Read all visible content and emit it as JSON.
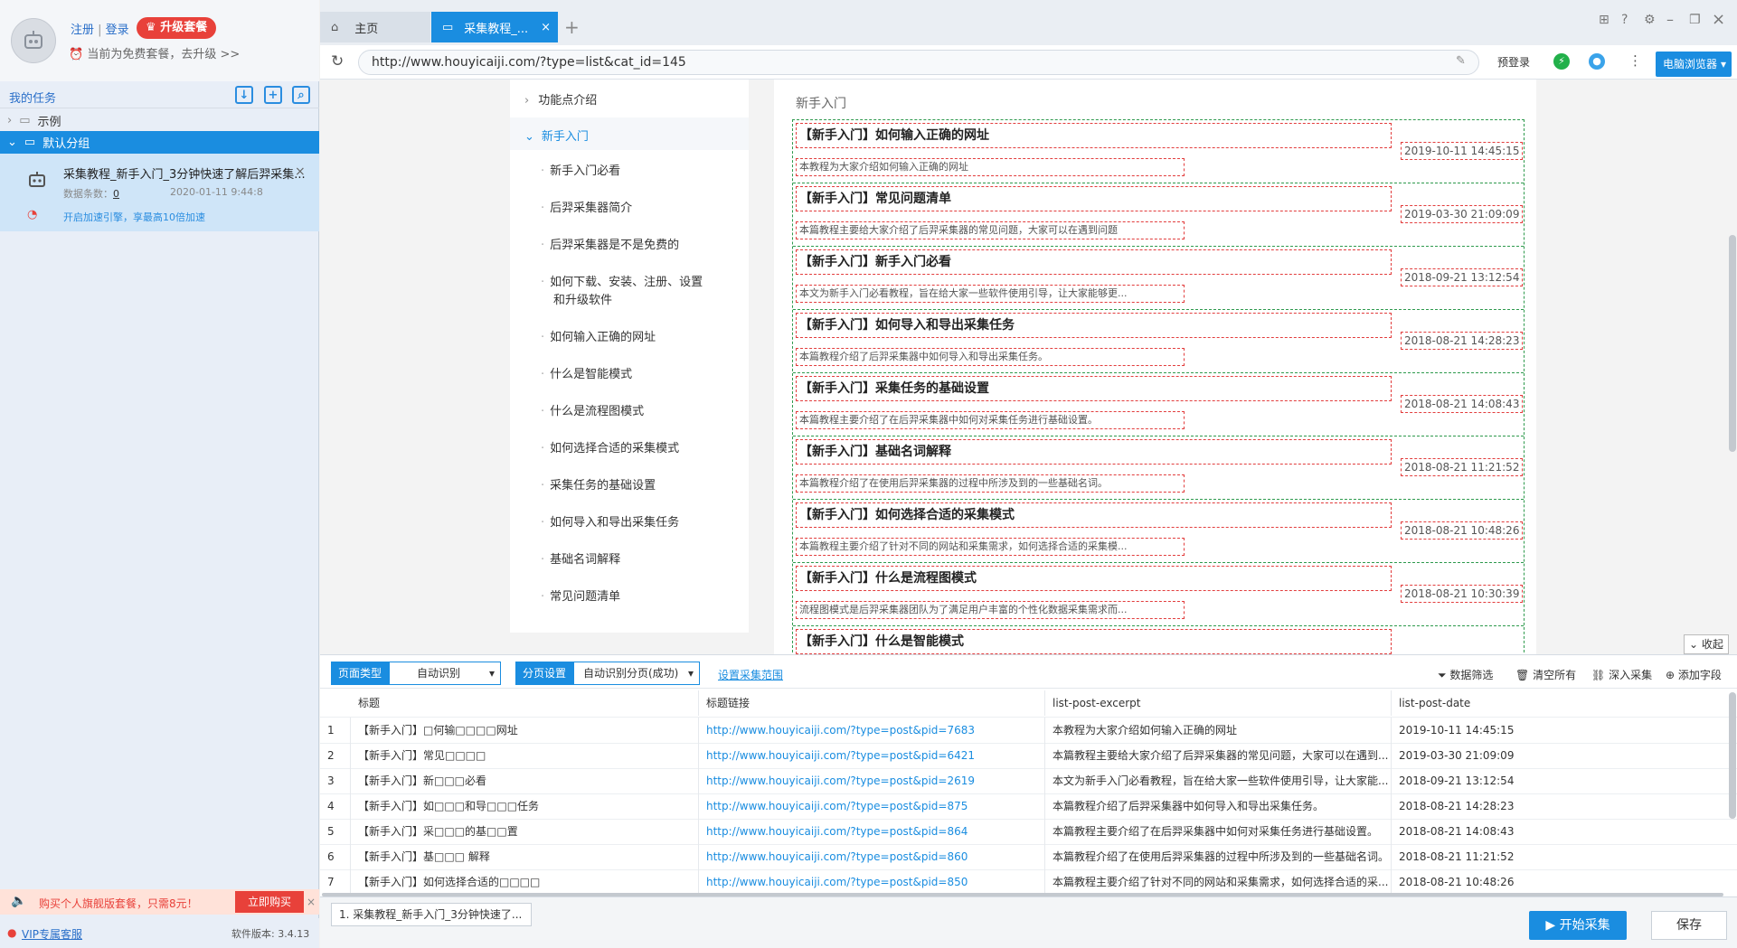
{
  "user": {
    "register": "注册",
    "separator": " | ",
    "login": "登录",
    "upgrade": "升级套餐",
    "plan_text": "当前为免费套餐，去升级 >>"
  },
  "sidebar": {
    "title": "我的任务",
    "tree": [
      {
        "label": "示例"
      },
      {
        "label": "默认分组"
      }
    ],
    "task": {
      "name": "采集教程_新手入门_3分钟快速了解后羿采集...",
      "count_label": "数据条数：",
      "count": "0",
      "date": "2020-01-11 9:44:8",
      "accel": "开启加速引擎，享最高10倍加速"
    },
    "ad": {
      "text": "购买个人旗舰版套餐，只需8元！",
      "button": "立即购买"
    },
    "vip": "VIP专属客服",
    "version": "软件版本: 3.4.13"
  },
  "tabs": [
    {
      "label": "主页"
    },
    {
      "label": "采集教程_..."
    }
  ],
  "address": {
    "url": "http://www.houyicaiji.com/?type=list&cat_id=145",
    "prelogin": "预登录",
    "browser": "电脑浏览器"
  },
  "web": {
    "nav": {
      "group1": "功能点介绍",
      "group2": "新手入门",
      "items": [
        "新手入门必看",
        "后羿采集器简介",
        "后羿采集器是不是免费的",
        "如何下载、安装、注册、设置",
        "和升级软件",
        "如何输入正确的网址",
        "什么是智能模式",
        "什么是流程图模式",
        "如何选择合适的采集模式",
        "采集任务的基础设置",
        "如何导入和导出采集任务",
        "基础名词解释",
        "常见问题清单"
      ]
    },
    "section_title": "新手入门",
    "posts": [
      {
        "title": "【新手入门】如何输入正确的网址",
        "excerpt": "本教程为大家介绍如何输入正确的网址",
        "date": "2019-10-11 14:45:15"
      },
      {
        "title": "【新手入门】常见问题清单",
        "excerpt": "本篇教程主要给大家介绍了后羿采集器的常见问题，大家可以在遇到问题",
        "date": "2019-03-30 21:09:09"
      },
      {
        "title": "【新手入门】新手入门必看",
        "excerpt": "本文为新手入门必看教程，旨在给大家一些软件使用引导，让大家能够更...",
        "date": "2018-09-21 13:12:54"
      },
      {
        "title": "【新手入门】如何导入和导出采集任务",
        "excerpt": "本篇教程介绍了后羿采集器中如何导入和导出采集任务。",
        "date": "2018-08-21 14:28:23"
      },
      {
        "title": "【新手入门】采集任务的基础设置",
        "excerpt": "本篇教程主要介绍了在后羿采集器中如何对采集任务进行基础设置。",
        "date": "2018-08-21 14:08:43"
      },
      {
        "title": "【新手入门】基础名词解释",
        "excerpt": "本篇教程介绍了在使用后羿采集器的过程中所涉及到的一些基础名词。",
        "date": "2018-08-21 11:21:52"
      },
      {
        "title": "【新手入门】如何选择合适的采集模式",
        "excerpt": "本篇教程主要介绍了针对不同的网站和采集需求，如何选择合适的采集模...",
        "date": "2018-08-21 10:48:26"
      },
      {
        "title": "【新手入门】什么是流程图模式",
        "excerpt": "流程图模式是后羿采集器团队为了满足用户丰富的个性化数据采集需求而...",
        "date": "2018-08-21 10:30:39"
      },
      {
        "title": "【新手入门】什么是智能模式",
        "excerpt": "",
        "date": ""
      }
    ],
    "collapse": "收起"
  },
  "config": {
    "page_type_label": "页面类型",
    "page_type_value": "自动识别",
    "paging_label": "分页设置",
    "paging_value": "自动识别分页(成功)",
    "range_link": "设置采集范围",
    "tools": [
      "数据筛选",
      "清空所有",
      "深入采集",
      "添加字段"
    ]
  },
  "table": {
    "headers": [
      "标题",
      "标题链接",
      "list-post-excerpt",
      "list-post-date"
    ],
    "rows": [
      {
        "n": "1",
        "title": "【新手入门】□何输□□□□网址",
        "link": "http://www.houyicaiji.com/?type=post&pid=7683",
        "excerpt": "本教程为大家介绍如何输入正确的网址",
        "date": "2019-10-11 14:45:15"
      },
      {
        "n": "2",
        "title": "【新手入门】常见□□□□",
        "link": "http://www.houyicaiji.com/?type=post&pid=6421",
        "excerpt": "本篇教程主要给大家介绍了后羿采集器的常见问题，大家可以在遇到...",
        "date": "2019-03-30 21:09:09"
      },
      {
        "n": "3",
        "title": "【新手入门】新□□□必看",
        "link": "http://www.houyicaiji.com/?type=post&pid=2619",
        "excerpt": "本文为新手入门必看教程，旨在给大家一些软件使用引导，让大家能...",
        "date": "2018-09-21 13:12:54"
      },
      {
        "n": "4",
        "title": "【新手入门】如□□□和导□□□任务",
        "link": "http://www.houyicaiji.com/?type=post&pid=875",
        "excerpt": "本篇教程介绍了后羿采集器中如何导入和导出采集任务。",
        "date": "2018-08-21 14:28:23"
      },
      {
        "n": "5",
        "title": "【新手入门】采□□□的基□□置",
        "link": "http://www.houyicaiji.com/?type=post&pid=864",
        "excerpt": "本篇教程主要介绍了在后羿采集器中如何对采集任务进行基础设置。",
        "date": "2018-08-21 14:08:43"
      },
      {
        "n": "6",
        "title": "【新手入门】基□□□  解释",
        "link": "http://www.houyicaiji.com/?type=post&pid=860",
        "excerpt": "本篇教程介绍了在使用后羿采集器的过程中所涉及到的一些基础名词。",
        "date": "2018-08-21 11:21:52"
      },
      {
        "n": "7",
        "title": "【新手入门】如何选择合适的□□□□",
        "link": "http://www.houyicaiji.com/?type=post&pid=850",
        "excerpt": "本篇教程主要介绍了针对不同的网站和采集需求，如何选择合适的采...",
        "date": "2018-08-21 10:48:26"
      }
    ]
  },
  "bottom": {
    "task_tab": "1. 采集教程_新手入门_3分钟快速了...",
    "start": "开始采集",
    "save": "保存"
  },
  "colors": {
    "accent": "#1a8de0",
    "danger": "#e8413a",
    "dashed_green": "#2e9a4d",
    "dashed_red": "#e23d3d"
  }
}
